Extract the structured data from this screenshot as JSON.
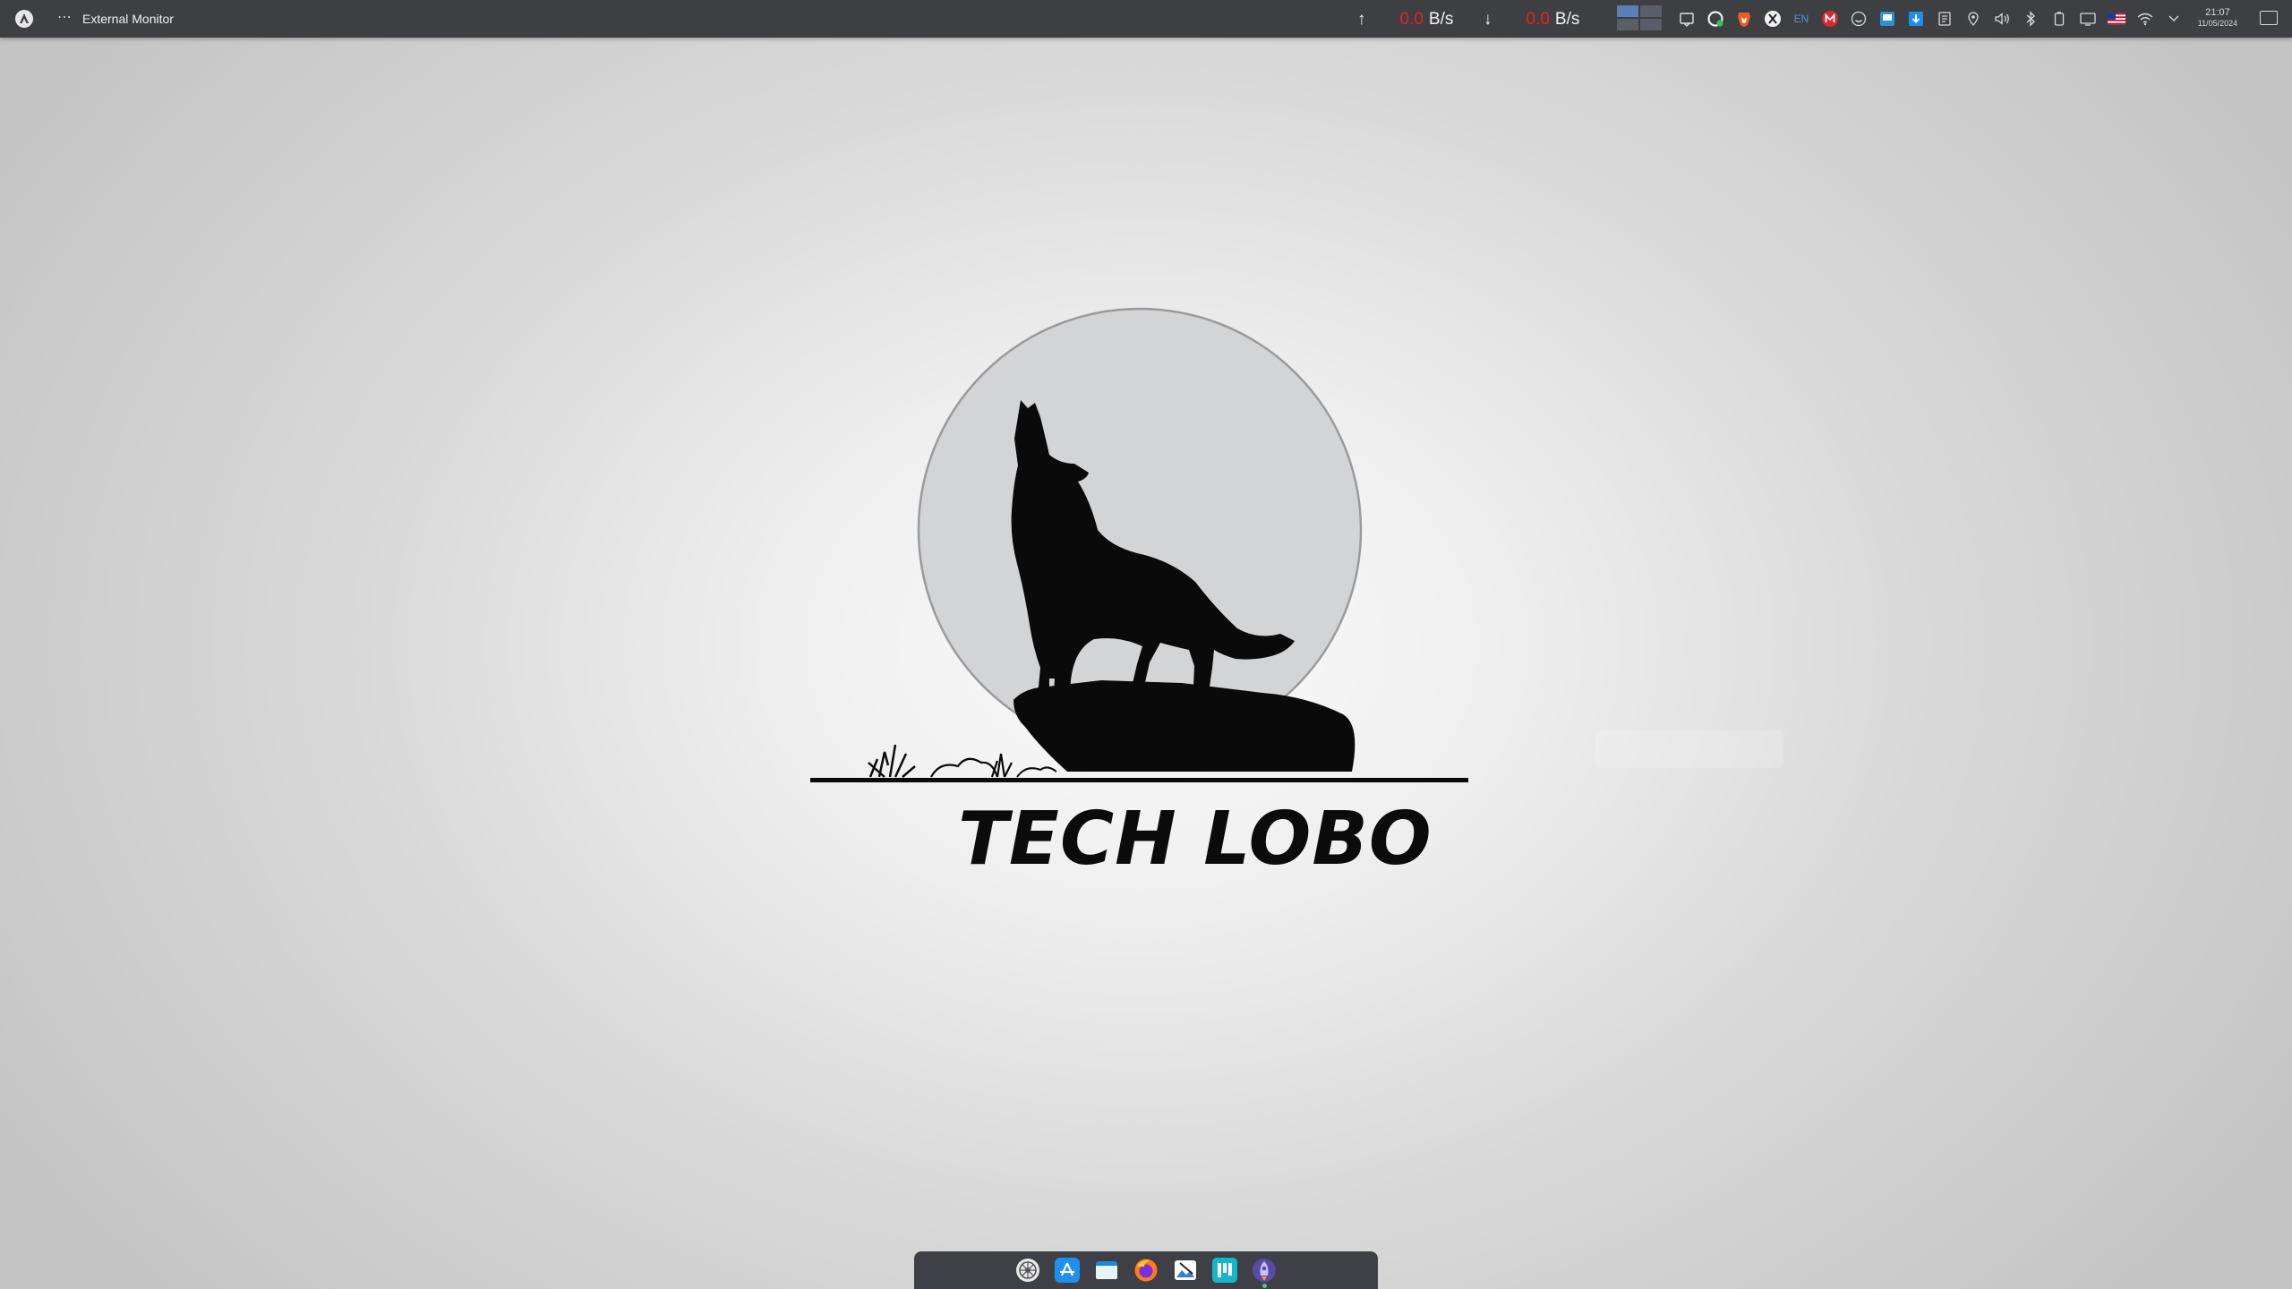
{
  "panel": {
    "window_title": "External Monitor",
    "menu_glyph": "⋯",
    "upload": {
      "arrow": "↑",
      "value": "0.0",
      "unit": "B/s"
    },
    "download": {
      "arrow": "↓",
      "value": "0.0",
      "unit": "B/s"
    },
    "workspaces": {
      "count": 4,
      "active": 1
    },
    "tray": {
      "language": "EN"
    },
    "clock": {
      "time": "21:07",
      "date": "11/05/2024"
    }
  },
  "logo": {
    "text": "TECH LOBO"
  },
  "dock": {
    "apps": [
      "system-settings-icon",
      "app-store-icon",
      "file-manager-icon",
      "firefox-icon",
      "image-editor-icon",
      "kanban-app-icon",
      "rocket-launcher-icon"
    ]
  },
  "colors": {
    "panel_bg": "#3d3f43",
    "speed_value": "#e8231e",
    "workspace_active": "#5a7fb5",
    "dock_bg": "#3e4045",
    "moon": "#d3d4d6"
  }
}
